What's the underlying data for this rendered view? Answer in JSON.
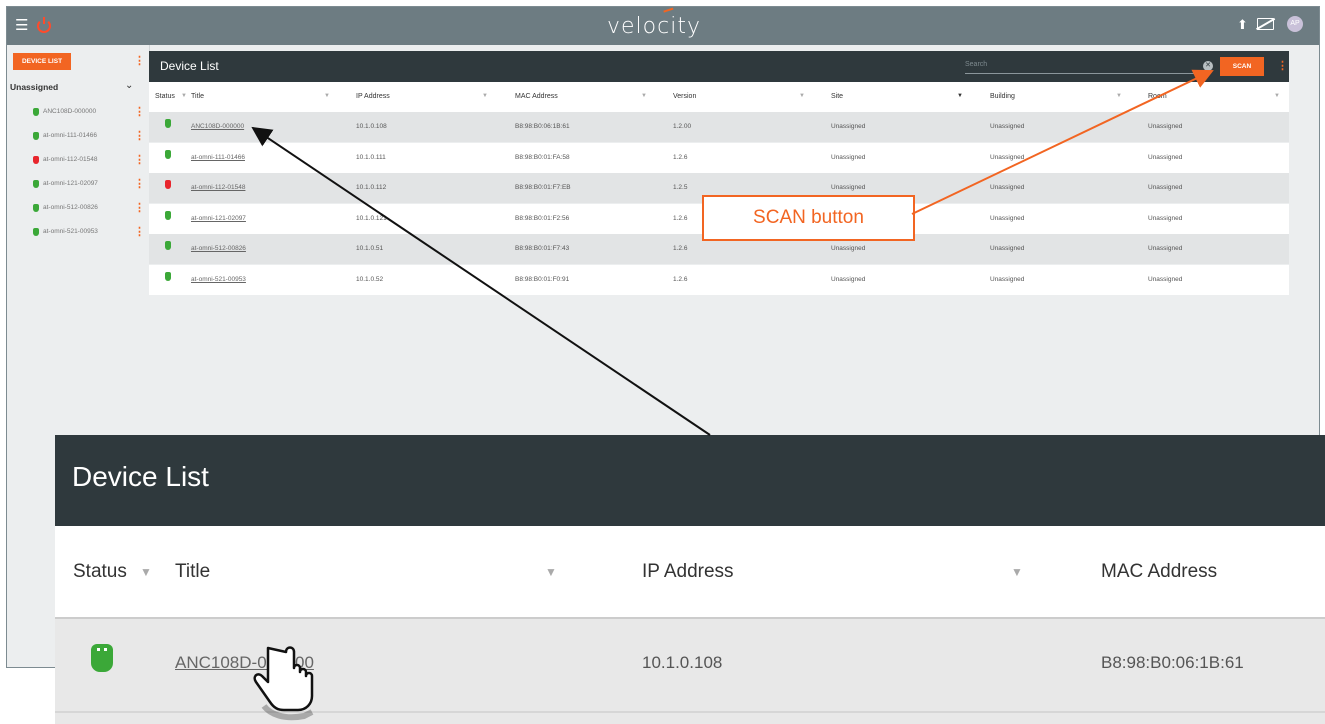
{
  "app": {
    "logo": "velocity",
    "avatar_initials": "AP",
    "accent_color": "#f26522",
    "icons": [
      "hamburger-menu-icon",
      "power-icon",
      "upload-icon",
      "display-off-icon",
      "user-avatar"
    ]
  },
  "sidebar": {
    "device_list_button": "DEVICE LIST",
    "group_label": "Unassigned",
    "items": [
      {
        "label": "ANC108D-000000",
        "status": "green"
      },
      {
        "label": "at-omni-111-01466",
        "status": "green"
      },
      {
        "label": "at-omni-112-01548",
        "status": "red"
      },
      {
        "label": "at-omni-121-02097",
        "status": "green"
      },
      {
        "label": "at-omni-512-00826",
        "status": "green"
      },
      {
        "label": "at-omni-521-00953",
        "status": "green"
      }
    ]
  },
  "panel": {
    "title": "Device List",
    "search_placeholder": "Search",
    "scan_label": "SCAN",
    "columns": [
      "Status",
      "Title",
      "IP Address",
      "MAC Address",
      "Version",
      "Site",
      "Building",
      "Room"
    ],
    "rows": [
      {
        "status": "green",
        "title": "ANC108D-000000",
        "ip": "10.1.0.108",
        "mac": "B8:98:B0:06:1B:61",
        "version": "1.2.00",
        "site": "Unassigned",
        "building": "Unassigned",
        "room": "Unassigned"
      },
      {
        "status": "green",
        "title": "at-omni-111-01466",
        "ip": "10.1.0.111",
        "mac": "B8:98:B0:01:FA:58",
        "version": "1.2.6",
        "site": "Unassigned",
        "building": "Unassigned",
        "room": "Unassigned"
      },
      {
        "status": "red",
        "title": "at-omni-112-01548",
        "ip": "10.1.0.112",
        "mac": "B8:98:B0:01:F7:EB",
        "version": "1.2.5",
        "site": "Unassigned",
        "building": "Unassigned",
        "room": "Unassigned"
      },
      {
        "status": "green",
        "title": "at-omni-121-02097",
        "ip": "10.1.0.121",
        "mac": "B8:98:B0:01:F2:56",
        "version": "1.2.6",
        "site": "Unassigned",
        "building": "Unassigned",
        "room": "Unassigned"
      },
      {
        "status": "green",
        "title": "at-omni-512-00826",
        "ip": "10.1.0.51",
        "mac": "B8:98:B0:01:F7:43",
        "version": "1.2.6",
        "site": "Unassigned",
        "building": "Unassigned",
        "room": "Unassigned"
      },
      {
        "status": "green",
        "title": "at-omni-521-00953",
        "ip": "10.1.0.52",
        "mac": "B8:98:B0:01:F0:91",
        "version": "1.2.6",
        "site": "Unassigned",
        "building": "Unassigned",
        "room": "Unassigned"
      }
    ]
  },
  "zoom": {
    "title": "Device List",
    "columns": [
      "Status",
      "Title",
      "IP Address",
      "MAC Address"
    ],
    "row": {
      "title": "ANC108D-000000",
      "ip": "10.1.0.108",
      "mac": "B8:98:B0:06:1B:61"
    }
  },
  "callout": {
    "label": "SCAN button"
  }
}
